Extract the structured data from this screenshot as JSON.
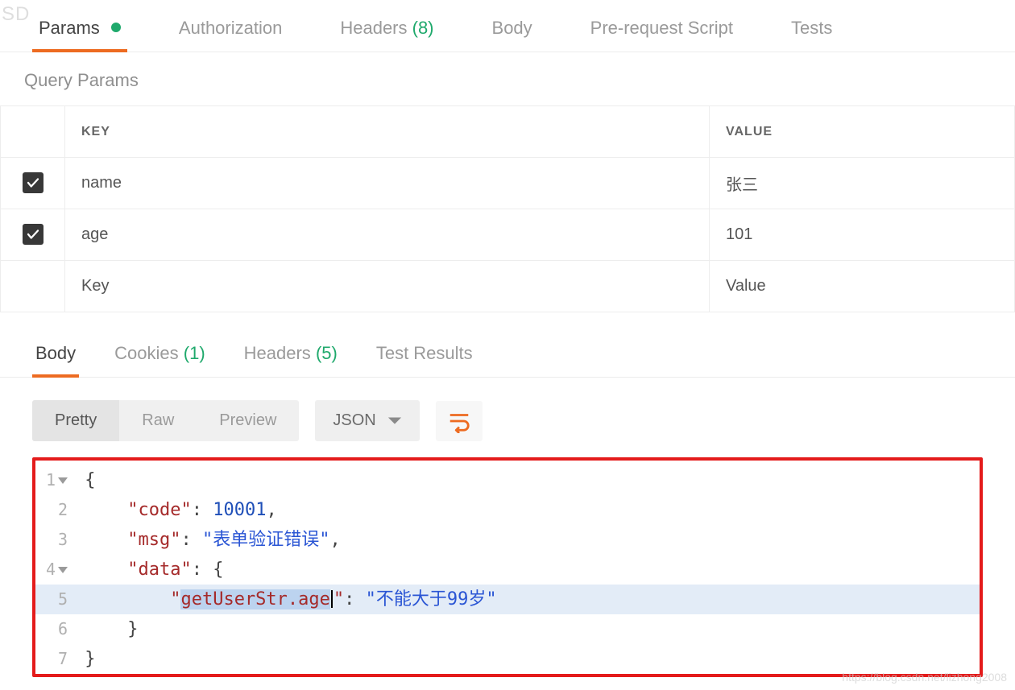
{
  "watermark_top": "SD",
  "watermark_bottom": "https://blog.csdn.net/lizhong2008",
  "request_tabs": {
    "params": "Params",
    "authorization": "Authorization",
    "headers": "Headers",
    "headers_count": "(8)",
    "body": "Body",
    "pre_request": "Pre-request Script",
    "tests": "Tests"
  },
  "section_title": "Query Params",
  "table": {
    "header_key": "KEY",
    "header_value": "VALUE",
    "rows": [
      {
        "checked": true,
        "key": "name",
        "value": "张三"
      },
      {
        "checked": true,
        "key": "age",
        "value": "101"
      }
    ],
    "placeholder_key": "Key",
    "placeholder_value": "Value"
  },
  "response_tabs": {
    "body": "Body",
    "cookies": "Cookies",
    "cookies_count": "(1)",
    "headers": "Headers",
    "headers_count": "(5)",
    "test_results": "Test Results"
  },
  "view": {
    "pretty": "Pretty",
    "raw": "Raw",
    "preview": "Preview",
    "format": "JSON"
  },
  "json_body": {
    "code": 10001,
    "msg": "表单验证错误",
    "data": {
      "getUserStr.age": "不能大于99岁"
    }
  },
  "json_lines": {
    "l1": "{",
    "l2_key": "\"code\"",
    "l2_val": "10001",
    "l3_key": "\"msg\"",
    "l3_val": "\"表单验证错误\"",
    "l4_key": "\"data\"",
    "l5_key_pre": "\"",
    "l5_key_sel": "getUserStr.age",
    "l5_key_post": "\"",
    "l5_val": "\"不能大于99岁\"",
    "l6": "}",
    "l7": "}"
  }
}
